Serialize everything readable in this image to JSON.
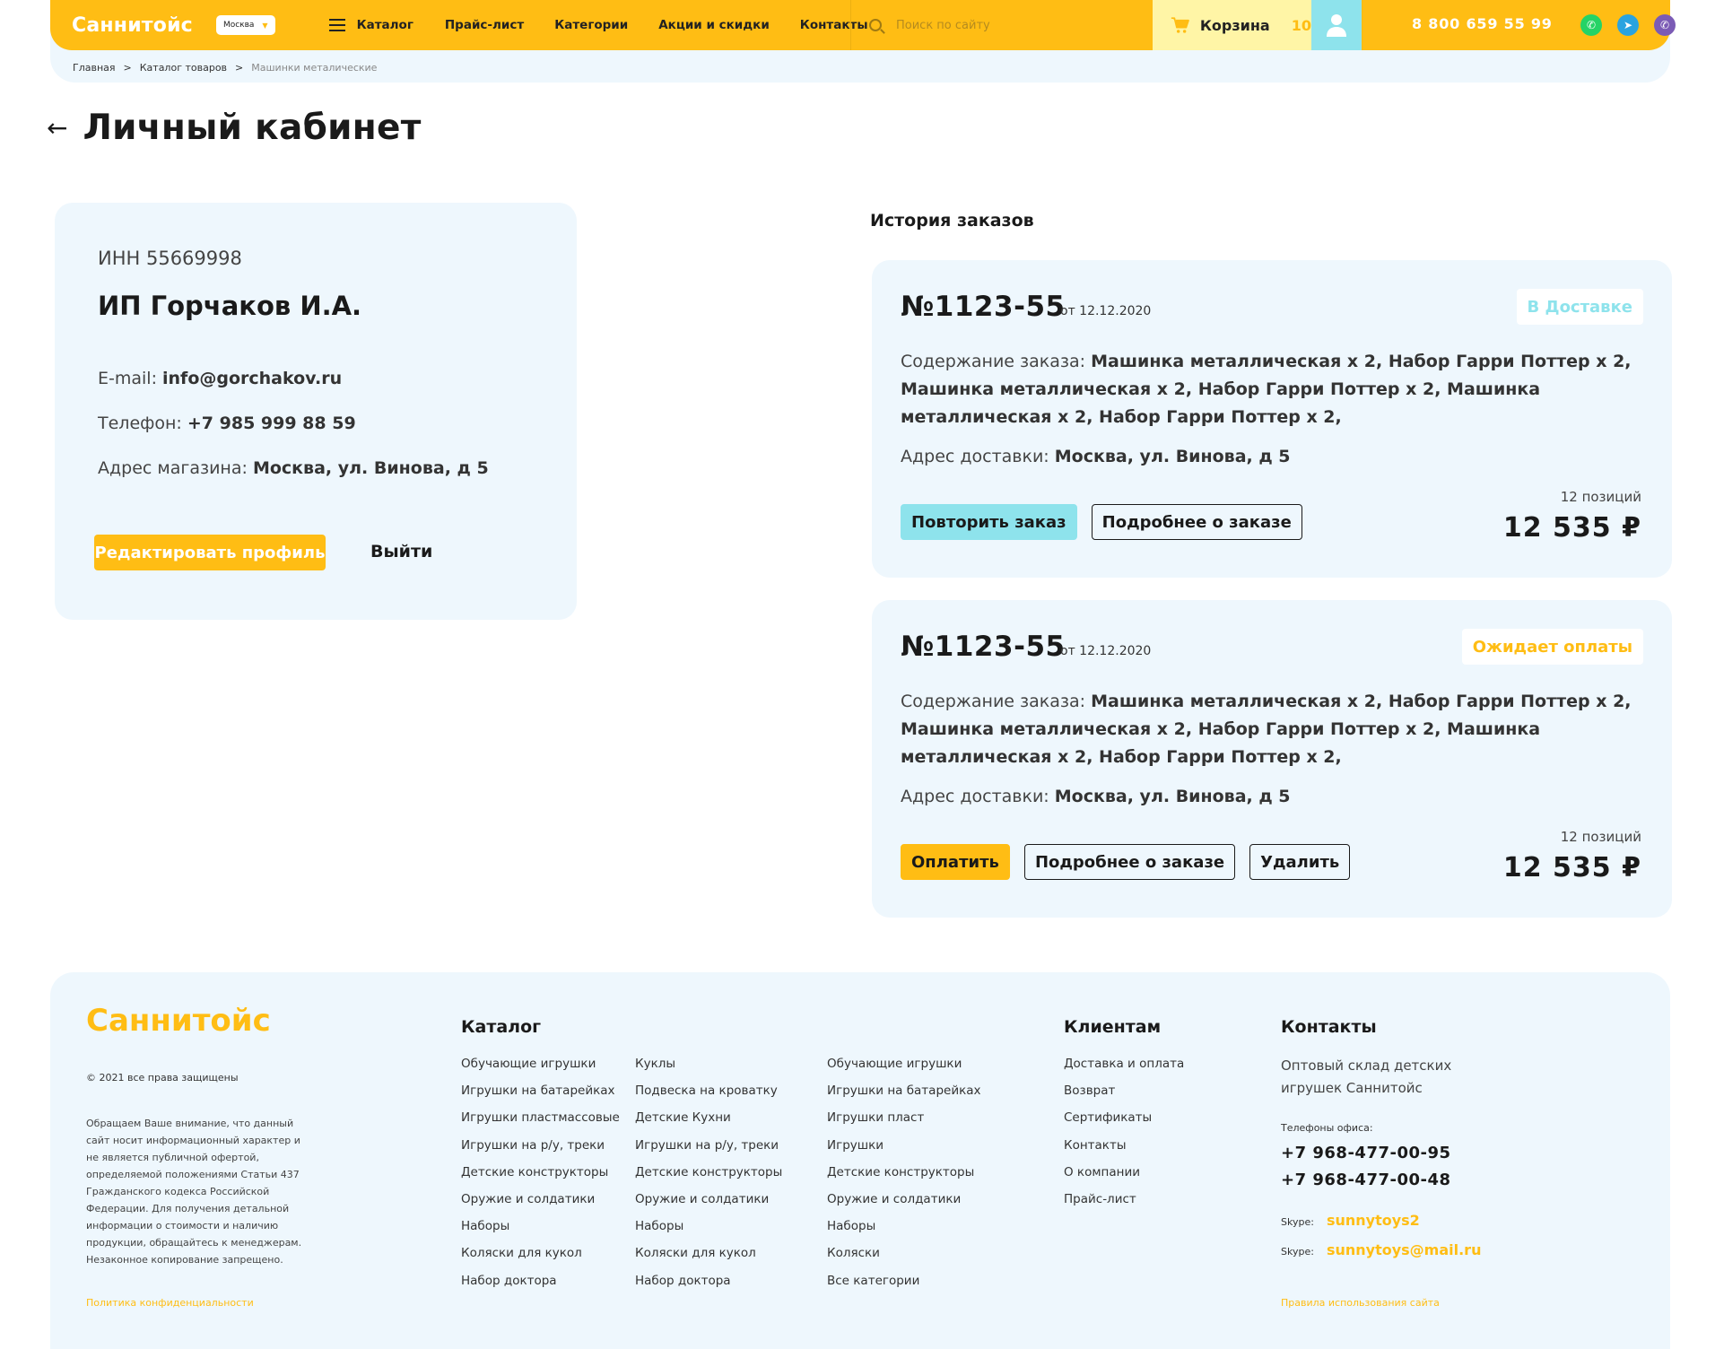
{
  "header": {
    "logo": "Саннитойс",
    "city": "Москва",
    "catalog_label": "Каталог",
    "nav": [
      "Прайс-лист",
      "Категории",
      "Акции и скидки",
      "Контакты"
    ],
    "search_placeholder": "Поиск по сайту",
    "cart_label": "Корзина",
    "cart_count": "10",
    "phone": "8 800 659 55 99",
    "messengers": [
      "whatsapp-icon",
      "telegram-icon",
      "viber-icon"
    ]
  },
  "breadcrumbs": [
    "Главная",
    ">",
    "Каталог товаров",
    ">",
    "Машинки металические"
  ],
  "page": {
    "title": "Личный кабинет"
  },
  "profile": {
    "inn": "ИНН 55669998",
    "company": "ИП Горчаков И.А.",
    "email_label": "E-mail: ",
    "email": "info@gorchakov.ru",
    "phone_label": "Телефон: ",
    "phone": "+7 985 999 88 59",
    "address_label": "Адрес магазина: ",
    "address": "Москва, ул. Винова, д 5",
    "edit_button": "Редактировать профиль",
    "logout_button": "Выйти"
  },
  "orders": {
    "title": "История заказов",
    "items": [
      {
        "number": "№1123-55",
        "date": "от 12.12.2020",
        "status": "В Доставке",
        "status_color": "#8ee3ec",
        "content_label": "Содержание заказа: ",
        "content": "Машинка металлическая х 2, Набор Гарри Поттер х 2,  Машинка металлическая х 2, Набор Гарри Поттер х 2,  Машинка металлическая х 2, Набор Гарри Поттер х 2,",
        "address_label": "Адрес доставки: ",
        "address": "Москва, ул. Винова, д 5",
        "buttons": [
          "Повторить заказ",
          "Подробнее о заказе"
        ],
        "positions": "12 позиций",
        "total": "12 535 ₽"
      },
      {
        "number": "№1123-55",
        "date": "от 12.12.2020",
        "status": "Ожидает оплаты",
        "status_color": "#ffbd14",
        "content_label": "Содержание заказа: ",
        "content": "Машинка металлическая х 2, Набор Гарри Поттер х 2,  Машинка металлическая х 2, Набор Гарри Поттер х 2,  Машинка металлическая х 2, Набор Гарри Поттер х 2,",
        "address_label": "Адрес доставки: ",
        "address": "Москва, ул. Винова, д 5",
        "buttons": [
          "Оплатить",
          "Подробнее о заказе",
          "Удалить"
        ],
        "positions": "12 позиций",
        "total": "12 535 ₽"
      }
    ]
  },
  "footer": {
    "logo": "Саннитойс",
    "copyright": "© 2021 все права защищены",
    "notice": "Обращаем Ваше внимание, что данный сайт носит информационный характер и не является публичной офертой, определяемой положениями Статьи 437 Гражданского кодекса Российской Федерации. Для получения детальной информации о стоимости и наличию продукции, обращайтесь к менеджерам. Незаконное копирование запрещено.",
    "privacy": "Политика конфиденциальности",
    "catalog_title": "Каталог",
    "catalog_col1": [
      "Обучающие игрушки",
      "Игрушки на батарейках",
      "Игрушки пластмассовые",
      "Игрушки на р/у, треки",
      "Детские конструкторы",
      "Оружие и солдатики",
      "Наборы",
      "Коляски для кукол",
      "Набор доктора"
    ],
    "catalog_col2": [
      "Куклы",
      "Подвеска на кроватку",
      "Детские Кухни",
      "Игрушки на р/у, треки",
      "Детские конструкторы",
      "Оружие и солдатики",
      "Наборы",
      "Коляски для кукол",
      "Набор доктора"
    ],
    "catalog_col3": [
      "Обучающие игрушки",
      "Игрушки на батарейках",
      "Игрушки пласт",
      "Игрушки",
      "Детские конструкторы",
      "Оружие и солдатики",
      "Наборы",
      "Коляски",
      "Все категории"
    ],
    "clients_title": "Клиентам",
    "clients": [
      "Доставка и оплата",
      "Возврат",
      "Сертификаты",
      "Контакты",
      "О компании",
      "Прайс-лист"
    ],
    "contacts_title": "Контакты",
    "contacts_desc": "Оптовый склад детских игрушек Саннитойс",
    "phones_label": "Телефоны офиса:",
    "phones": [
      "+7 968-477-00-95",
      "+7 968-477-00-48"
    ],
    "skype_label": "Skype:",
    "skypes": [
      "sunnytoys2",
      "sunnytoys@mail.ru"
    ],
    "rules": "Правила использования сайта"
  }
}
